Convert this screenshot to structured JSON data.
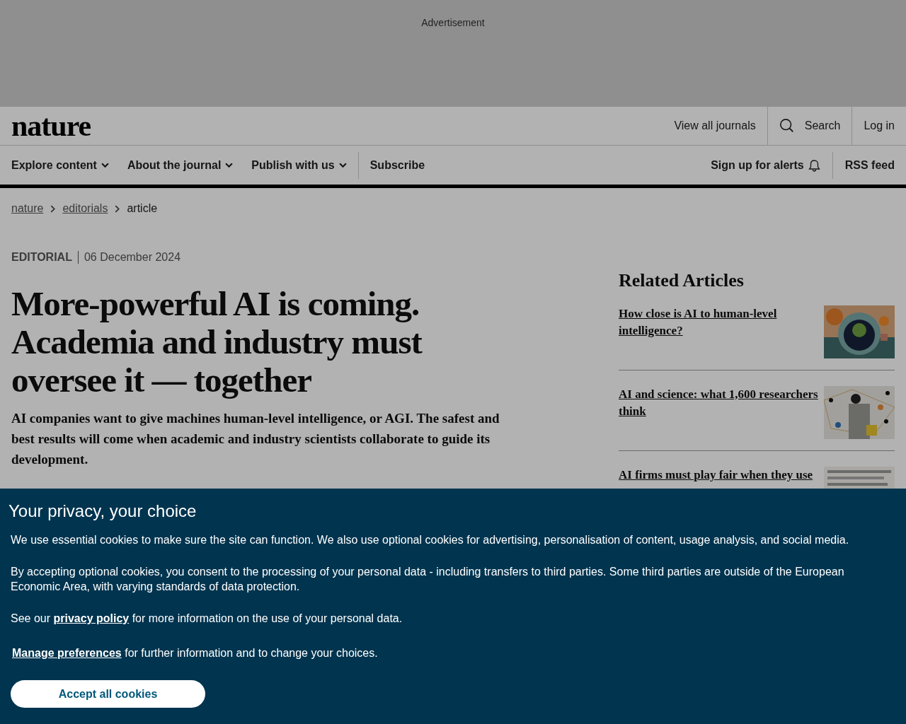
{
  "advertisement": {
    "label": "Advertisement"
  },
  "header": {
    "logo": "nature",
    "links": [
      {
        "label": "View all journals",
        "kind": "text"
      },
      {
        "label": "Search",
        "kind": "search"
      },
      {
        "label": "Log in",
        "kind": "text"
      }
    ]
  },
  "nav": {
    "items": [
      {
        "label": "Explore content",
        "dropdown": true
      },
      {
        "label": "About the journal",
        "dropdown": true
      },
      {
        "label": "Publish with us",
        "dropdown": true
      },
      {
        "label": "Subscribe",
        "dropdown": false
      }
    ],
    "right": [
      {
        "label": "Sign up for alerts",
        "kind": "alerts"
      },
      {
        "label": "RSS feed",
        "kind": "text"
      }
    ]
  },
  "breadcrumb": [
    {
      "label": "nature",
      "link": true
    },
    {
      "label": "editorials",
      "link": true
    },
    {
      "label": "article",
      "link": false
    }
  ],
  "article": {
    "type": "EDITORIAL",
    "date": "06 December 2024",
    "title": "More-powerful AI is coming. Academia and industry must oversee it — together",
    "standfirst": "AI companies want to give machines human-level intelligence, or AGI. The safest and best results will come when academic and industry scientists collaborate to guide its development."
  },
  "related": {
    "title": "Related Articles",
    "items": [
      {
        "title": "How close is AI to human-level intelligence?"
      },
      {
        "title": "AI and science: what 1,600 researchers think"
      },
      {
        "title": "AI firms must play fair when they use"
      }
    ]
  },
  "cookie_banner": {
    "title": "Your privacy, your choice",
    "paragraphs": [
      {
        "text": "We use essential cookies to make sure the site can function. We also use optional cookies for advertising, personalisation of content, usage analysis, and social media."
      },
      {
        "text": "By accepting optional cookies, you consent to the processing of your personal data - including transfers to third parties. Some third parties are outside of the European Economic Area, with varying standards of data protection."
      },
      {
        "before": "See our",
        "link": "privacy policy",
        "after": "for more information on the use of your personal data."
      },
      {
        "link": "Manage preferences",
        "after": "for further information and to change your choices."
      }
    ],
    "button": "Accept all cookies"
  }
}
